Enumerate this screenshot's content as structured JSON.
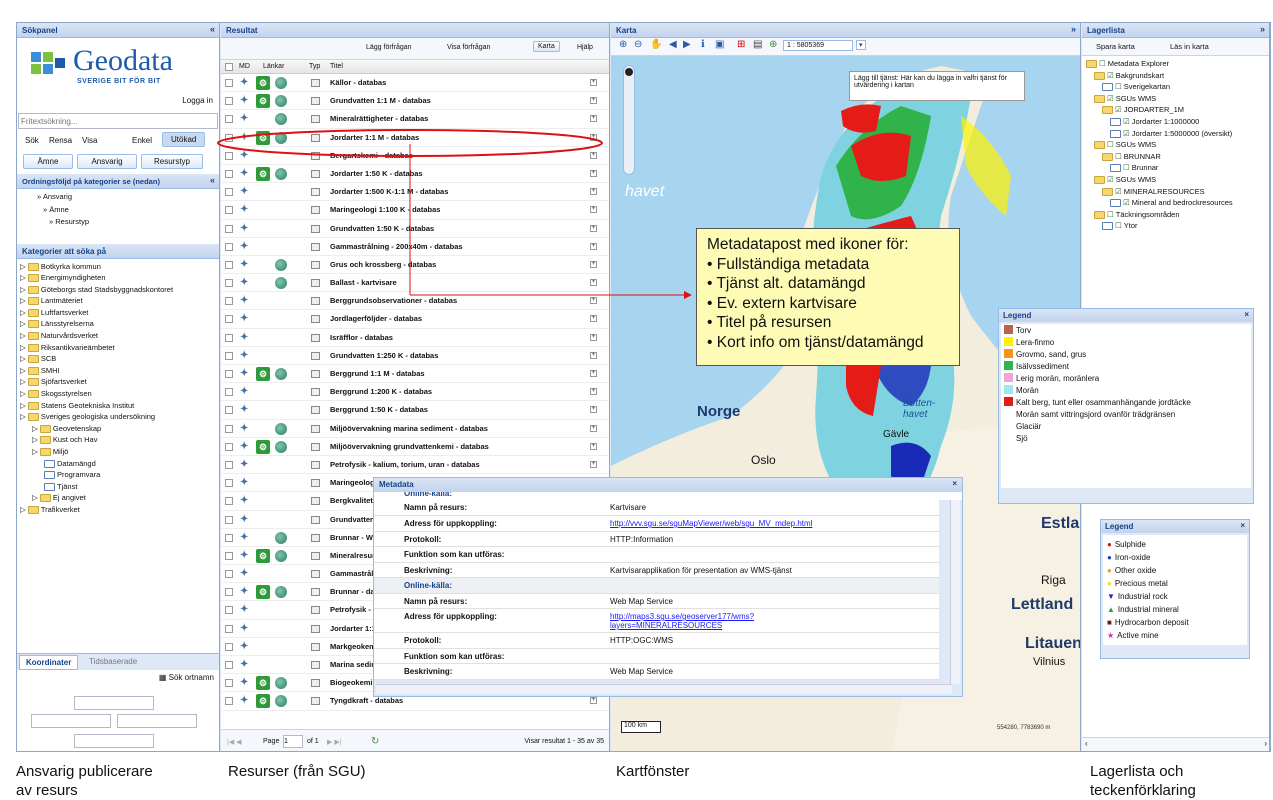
{
  "sok": {
    "title": "Sökpanel",
    "logo_word": "Geodata",
    "logo_tag": "SVERIGE BIT FÖR BIT",
    "login": "Logga in",
    "search_placeholder": "Fritextsökning...",
    "actions": [
      "Sök",
      "Rensa",
      "Visa"
    ],
    "mode_simple": "Enkel",
    "mode_ext": "Utökad",
    "tabs": [
      "Ämne",
      "Ansvarig",
      "Resurstyp"
    ],
    "order_title": "Ordningsföljd på kategorier se (nedan)",
    "order": [
      "» Ansvarig",
      "» Ämne",
      "» Resurstyp"
    ],
    "cat_title": "Kategorier att söka på",
    "cats": [
      "Botkyrka kommun",
      "Energimyndigheten",
      "Göteborgs stad Stadsbyggnadskontoret",
      "Lantmäteriet",
      "Luftfartsverket",
      "Länsstyrelserna",
      "Naturvårdsverket",
      "Riksantikvarieämbetet",
      "SCB",
      "SMHI",
      "Sjöfartsverket",
      "Skogsstyrelsen",
      "Statens Geotekniska Institut",
      "Sveriges geologiska undersökning",
      "Geovetenskap",
      "Kust och Hav",
      "Miljö",
      "Datamängd",
      "Programvara",
      "Tjänst",
      "Ej angivet",
      "Trafikverket"
    ],
    "coord_tab": "Koordinater",
    "time_tab": "Tidsbaserade",
    "place": "Sök ortnamn"
  },
  "res": {
    "title": "Resultat",
    "tools": [
      "Lägg förfrågan",
      "Visa förfrågan",
      "Karta",
      "Hjälp"
    ],
    "cols": [
      "MD",
      "Länkar",
      "Typ",
      "Titel"
    ],
    "rows": [
      {
        "t": "Källor - databas",
        "g": 1,
        "w": 1
      },
      {
        "t": "Grundvatten 1:1 M - databas",
        "g": 1,
        "w": 1
      },
      {
        "t": "Mineralrättigheter - databas",
        "g": 0,
        "w": 1
      },
      {
        "t": "Jordarter 1:1 M - databas",
        "g": 1,
        "w": 1
      },
      {
        "t": "Bergartskemi - databas",
        "g": 0,
        "w": 0
      },
      {
        "t": "Jordarter 1:50 K - databas",
        "g": 1,
        "w": 1
      },
      {
        "t": "Jordarter 1:500 K-1:1 M - databas",
        "g": 0,
        "w": 0
      },
      {
        "t": "Maringeologi 1:100 K - databas",
        "g": 0,
        "w": 0
      },
      {
        "t": "Grundvatten 1:50 K - databas",
        "g": 0,
        "w": 0
      },
      {
        "t": "Gammastrålning - 200x40m - databas",
        "g": 0,
        "w": 0
      },
      {
        "t": "Grus och krossberg - databas",
        "g": 0,
        "w": 1
      },
      {
        "t": "Ballast - kartvisare",
        "g": 0,
        "w": 1
      },
      {
        "t": "Berggrundsobservationer - databas",
        "g": 0,
        "w": 0
      },
      {
        "t": "Jordlagerföljder - databas",
        "g": 0,
        "w": 0
      },
      {
        "t": "Isräfflor - databas",
        "g": 0,
        "w": 0
      },
      {
        "t": "Grundvatten 1:250 K - databas",
        "g": 0,
        "w": 0
      },
      {
        "t": "Berggrund 1:1 M - databas",
        "g": 1,
        "w": 1
      },
      {
        "t": "Berggrund 1:200 K - databas",
        "g": 0,
        "w": 0
      },
      {
        "t": "Berggrund 1:50 K - databas",
        "g": 0,
        "w": 0
      },
      {
        "t": "Miljöövervakning marina sediment - databas",
        "g": 0,
        "w": 1
      },
      {
        "t": "Miljöövervakning grundvattenkemi - databas",
        "g": 1,
        "w": 1
      },
      {
        "t": "Petrofysik - kalium, torium, uran - databas",
        "g": 0,
        "w": 0
      },
      {
        "t": "Maringeologi",
        "g": 0,
        "w": 0
      },
      {
        "t": "Bergkvalitet",
        "g": 0,
        "w": 0
      },
      {
        "t": "Grundvatten",
        "g": 0,
        "w": 0
      },
      {
        "t": "Brunnar - WM",
        "g": 0,
        "w": 1
      },
      {
        "t": "Mineralresur",
        "g": 1,
        "w": 1
      },
      {
        "t": "Gammastråln",
        "g": 0,
        "w": 0
      },
      {
        "t": "Brunnar - dat",
        "g": 1,
        "w": 1
      },
      {
        "t": "Petrofysik - c",
        "g": 0,
        "w": 0
      },
      {
        "t": "Jordarter 1:1",
        "g": 0,
        "w": 0
      },
      {
        "t": "Markgeokem",
        "g": 0,
        "w": 0
      },
      {
        "t": "Marina sedin",
        "g": 0,
        "w": 0
      },
      {
        "t": "Biogeokemi",
        "g": 1,
        "w": 1
      },
      {
        "t": "Tyngdkraft - databas",
        "g": 1,
        "w": 1
      }
    ],
    "page_label": "Page",
    "page_value": "1",
    "page_of": "of 1",
    "showing": "Visar resultat 1 - 35 av 35"
  },
  "karta": {
    "title": "Karta",
    "scale": "1 : 5805369",
    "tooltip": "Lägg till tjänst: Här kan du lägga in valfri tjänst för utvärdering i kartan",
    "places": [
      "havet",
      "Norge",
      "Botten-havet",
      "Oslo",
      "Gävle",
      "Estlan",
      "Riga",
      "Lettland",
      "Litauen",
      "Vilnius"
    ],
    "scalebar": "100 km",
    "coords": "554280, 7783690 m"
  },
  "callout": {
    "head": "Metadatapost med ikoner för:",
    "items": [
      "• Fullständiga metadata",
      "• Tjänst alt. datamängd",
      "• Ev. extern kartvisare",
      "• Titel på resursen",
      "• Kort info om tjänst/datamängd"
    ]
  },
  "lager": {
    "title": "Lagerlista",
    "btns": [
      "Spara karta",
      "Läs in karta"
    ],
    "tree": [
      "Metadata Explorer",
      "Bakgrundskart",
      "Sverigekartan",
      "SGUs WMS",
      "JORDARTER_1M",
      "Jordarter 1:1000000",
      "Jordarter 1:5000000 (översikt)",
      "SGUs WMS",
      "BRUNNAR",
      "Brunnar",
      "SGUs WMS",
      "MINERALRESOURCES",
      "Mineral and bedrockresources",
      "Täckningsområden",
      "Ytor"
    ]
  },
  "legend1": {
    "title": "Legend",
    "items": [
      {
        "n": "Torv",
        "c": "#b5654a"
      },
      {
        "n": "Lera-finmo",
        "c": "#fff200"
      },
      {
        "n": "Grovmo, sand, grus",
        "c": "#f7941d"
      },
      {
        "n": "Isälvssediment",
        "c": "#2fb34a"
      },
      {
        "n": "Lerig morän, moränlera",
        "c": "#f2a3d9"
      },
      {
        "n": "Morän",
        "c": "#9fe6f0"
      },
      {
        "n": "Kalt berg, tunt eller osammanhängande jordtäcke",
        "c": "#e41b17"
      },
      {
        "n": "Morän samt vittringsjord ovanför trädgränsen",
        "c": "#ffffff"
      },
      {
        "n": "Glaciär",
        "c": "#ffffff"
      },
      {
        "n": "Sjö",
        "c": "#ffffff"
      }
    ]
  },
  "legend2": {
    "title": "Legend",
    "items": [
      {
        "n": "Sulphide",
        "c": "#d11a1a",
        "s": "●"
      },
      {
        "n": "Iron-oxide",
        "c": "#1f3fbf",
        "s": "●"
      },
      {
        "n": "Other oxide",
        "c": "#f29b18",
        "s": "●"
      },
      {
        "n": "Precious metal",
        "c": "#f0e11c",
        "s": "●"
      },
      {
        "n": "Industrial rock",
        "c": "#1a2ab8",
        "s": "▼"
      },
      {
        "n": "Industrial mineral",
        "c": "#28a33c",
        "s": "▲"
      },
      {
        "n": "Hydrocarbon deposit",
        "c": "#6e1a1a",
        "s": "■"
      },
      {
        "n": "Active mine",
        "c": "#e020c8",
        "s": "★"
      }
    ]
  },
  "metadata": {
    "title": "Metadata",
    "cut": "Online-källa:",
    "rows": [
      {
        "k": "Namn på resurs:",
        "v": "Kartvisare",
        "link": false
      },
      {
        "k": "Adress för uppkoppling:",
        "v": "http://vvv.sgu.se/sguMapViewer/web/sgu_MV_mdep.html",
        "link": true
      },
      {
        "k": "Protokoll:",
        "v": "HTTP:Information",
        "link": false
      },
      {
        "k": "Funktion som kan utföras:",
        "v": "",
        "link": false
      },
      {
        "k": "Beskrivning:",
        "v": "Kartvisarapplikation för presentation av WMS-tjänst",
        "link": false
      },
      {
        "k": "Online-källa:",
        "v": "",
        "link": false,
        "sec": true
      },
      {
        "k": "Namn på resurs:",
        "v": "Web Map Service",
        "link": false
      },
      {
        "k": "Adress för uppkoppling:",
        "v": "http://maps3.sgu.se/geoserver177/wms?",
        "v2": "layers=MINERALRESOURCES",
        "link": true
      },
      {
        "k": "Protokoll:",
        "v": "HTTP:OGC:WMS",
        "link": false
      },
      {
        "k": "Funktion som kan utföras:",
        "v": "",
        "link": false
      },
      {
        "k": "Beskrivning:",
        "v": "Web Map Service",
        "link": false
      }
    ]
  },
  "captions": {
    "a": "Ansvarig publicerare\nav resurs",
    "b": "Resurser (från SGU)",
    "c": "Kartfönster",
    "d": "Lagerlista och\nteckenförklaring"
  }
}
